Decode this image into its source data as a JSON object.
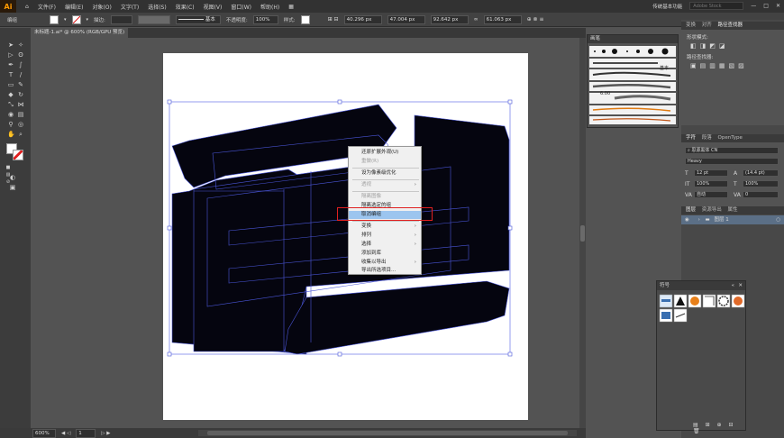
{
  "app": {
    "logo": "Ai",
    "menu": [
      "文件(F)",
      "编辑(E)",
      "对象(O)",
      "文字(T)",
      "选择(S)",
      "效果(C)",
      "视图(V)",
      "窗口(W)",
      "帮助(H)"
    ],
    "workspace": "传统基本功能",
    "search_placeholder": "Adobe Stock"
  },
  "control_bar": {
    "group_label": "编组",
    "stroke_label": "描边:",
    "brush_label": "基本",
    "opacity_label": "不透明度:",
    "opacity_value": "100%",
    "style_label": "样式:",
    "x_value": "40.296 px",
    "y_value": "47.004 px",
    "w_value": "92.642 px",
    "h_value": "61.063 px"
  },
  "document": {
    "tab_title": "未标题-1.ai* @ 600% (RGB/GPU 预览)"
  },
  "context_menu": {
    "items": [
      {
        "label": "还原扩展外观(U)",
        "disabled": false,
        "submenu": false,
        "highlight": false
      },
      {
        "label": "重做(R)",
        "disabled": true,
        "submenu": false,
        "highlight": false
      },
      {
        "label": "设为像素级优化",
        "disabled": false,
        "submenu": false,
        "highlight": false
      },
      {
        "label": "透视",
        "disabled": true,
        "submenu": true,
        "highlight": false
      },
      {
        "label": "隔离图像",
        "disabled": true,
        "submenu": false,
        "highlight": false
      },
      {
        "label": "隔离选定的组",
        "disabled": false,
        "submenu": false,
        "highlight": false
      },
      {
        "label": "取消编组",
        "disabled": false,
        "submenu": false,
        "highlight": true
      },
      {
        "label": "变换",
        "disabled": false,
        "submenu": true,
        "highlight": false
      },
      {
        "label": "排列",
        "disabled": false,
        "submenu": true,
        "highlight": false
      },
      {
        "label": "选择",
        "disabled": false,
        "submenu": true,
        "highlight": false
      },
      {
        "label": "添加到库",
        "disabled": false,
        "submenu": false,
        "highlight": false
      },
      {
        "label": "收集以导出",
        "disabled": false,
        "submenu": true,
        "highlight": false
      },
      {
        "label": "导出所选项目...",
        "disabled": false,
        "submenu": false,
        "highlight": false
      }
    ]
  },
  "status_bar": {
    "zoom": "600%",
    "page": "1",
    "mode": "选择"
  },
  "brushes_panel": {
    "title": "画笔",
    "basic_label": "基本",
    "size_value": "6.00"
  },
  "right_panels": {
    "top_tabs": [
      "变换",
      "对齐",
      "路径查找器"
    ],
    "shape_mode_label": "形状模式:",
    "pathfinder_label": "路径查找器:",
    "char_tabs": [
      "字符",
      "段落",
      "OpenType"
    ],
    "font_search": "思源黑体 CN",
    "font_style": "Heavy",
    "font_size": "12 pt",
    "leading": "(14.4 pt)",
    "scale_v": "100%",
    "scale_h": "100%",
    "tracking": "自动",
    "kerning": "0",
    "layer_tabs": [
      "图层",
      "资源导出",
      "属性"
    ],
    "layer_name": "图层 1"
  },
  "symbols_panel": {
    "title": "符号"
  },
  "colors": {
    "accent_red": "#e02020",
    "highlight_blue": "#9cc5ef",
    "selection_blue": "#4a56d8"
  }
}
